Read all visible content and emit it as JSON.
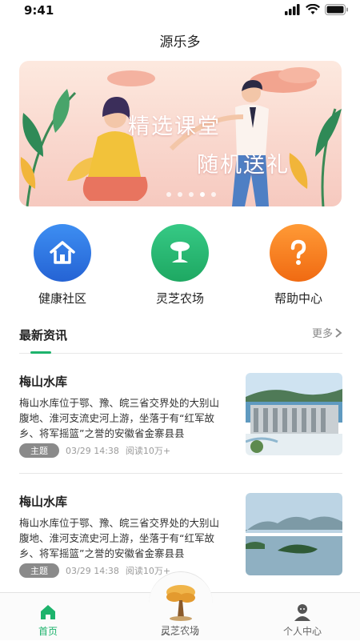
{
  "status_bar": {
    "time": "9:41"
  },
  "header": {
    "title": "源乐多"
  },
  "banner": {
    "line1": "精选课堂",
    "line2": "随机送礼",
    "slides": 5,
    "active_slide": 4
  },
  "quick_entries": [
    {
      "label": "健康社区",
      "icon": "house-icon",
      "color": "#2f7de6"
    },
    {
      "label": "灵芝农场",
      "icon": "sprout-icon",
      "color": "#22b573"
    },
    {
      "label": "帮助中心",
      "icon": "question-icon",
      "color": "#f27b1c"
    }
  ],
  "news": {
    "section_title": "最新资讯",
    "more_label": "更多",
    "items": [
      {
        "title": "梅山水库",
        "desc": "梅山水库位于鄂、豫、皖三省交界处的大别山腹地、淮河支流史河上游，坐落于有“红军故乡、将军摇篮”之誉的安徽省金寨县县",
        "tag": "主题",
        "time": "03/29 14:38",
        "reads": "阅读10万+"
      },
      {
        "title": "梅山水库",
        "desc": "梅山水库位于鄂、豫、皖三省交界处的大别山腹地、淮河支流史河上游，坐落于有“红军故乡、将军摇篮”之誉的安徽省金寨县县",
        "tag": "主题",
        "time": "03/29 14:38",
        "reads": "阅读10万+"
      }
    ]
  },
  "tabbar": {
    "tabs": [
      {
        "label": "首页",
        "icon": "home-icon",
        "active": true
      },
      {
        "label": "灵芝农场",
        "icon": "farm-tree-icon",
        "active": false
      },
      {
        "label": "个人中心",
        "icon": "user-icon",
        "active": false
      }
    ]
  },
  "colors": {
    "accent": "#1db36c",
    "tag_bg": "#8a8a8a"
  }
}
